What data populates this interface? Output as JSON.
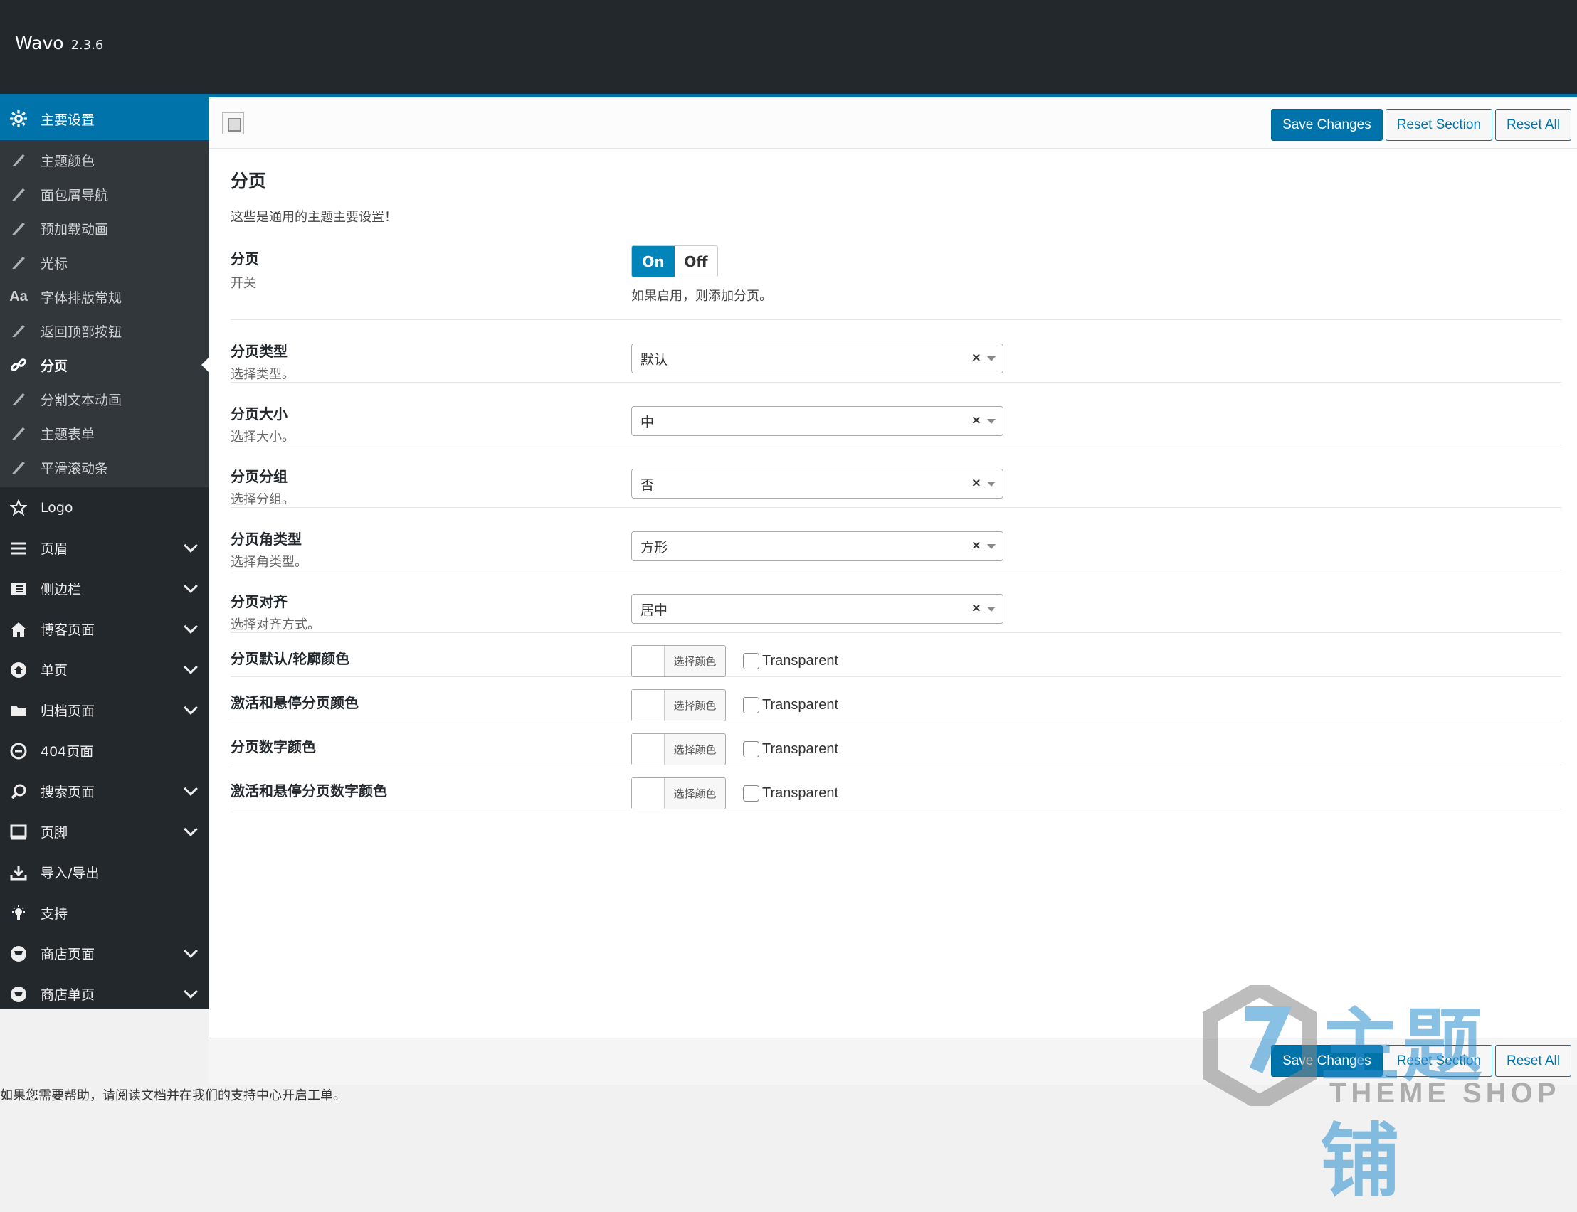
{
  "app": {
    "name": "Wavo",
    "version": "2.3.6"
  },
  "sidebar": {
    "active_section": "主要设置",
    "sub_items": [
      {
        "label": "主题颜色",
        "icon": "brush-icon"
      },
      {
        "label": "面包屑导航",
        "icon": "brush-icon"
      },
      {
        "label": "预加载动画",
        "icon": "brush-icon"
      },
      {
        "label": "光标",
        "icon": "brush-icon"
      },
      {
        "label": "字体排版常规",
        "icon": "font-icon"
      },
      {
        "label": "返回顶部按钮",
        "icon": "brush-icon"
      },
      {
        "label": "分页",
        "icon": "link-icon",
        "current": true
      },
      {
        "label": "分割文本动画",
        "icon": "brush-icon"
      },
      {
        "label": "主题表单",
        "icon": "brush-icon"
      },
      {
        "label": "平滑滚动条",
        "icon": "brush-icon"
      }
    ],
    "main_items": [
      {
        "label": "Logo",
        "icon": "star-icon",
        "expandable": false
      },
      {
        "label": "页眉",
        "icon": "menu-icon",
        "expandable": true
      },
      {
        "label": "侧边栏",
        "icon": "list-icon",
        "expandable": true
      },
      {
        "label": "博客页面",
        "icon": "home-icon",
        "expandable": true
      },
      {
        "label": "单页",
        "icon": "home-circle-icon",
        "expandable": true
      },
      {
        "label": "归档页面",
        "icon": "folder-icon",
        "expandable": true
      },
      {
        "label": "404页面",
        "icon": "minus-circle-icon",
        "expandable": false
      },
      {
        "label": "搜索页面",
        "icon": "search-icon",
        "expandable": true
      },
      {
        "label": "页脚",
        "icon": "monitor-icon",
        "expandable": true
      },
      {
        "label": "导入/导出",
        "icon": "download-icon",
        "expandable": false
      },
      {
        "label": "支持",
        "icon": "lightbulb-icon",
        "expandable": false
      },
      {
        "label": "商店页面",
        "icon": "cart-icon",
        "expandable": true
      },
      {
        "label": "商店单页",
        "icon": "cart-icon",
        "expandable": true
      }
    ]
  },
  "toolbar": {
    "save": "Save Changes",
    "reset_section": "Reset Section",
    "reset_all": "Reset All"
  },
  "section": {
    "title": "分页",
    "desc": "这些是通用的主题主要设置！"
  },
  "toggle": {
    "label": "分页",
    "sub": "开关",
    "on": "On",
    "off": "Off",
    "value": "On",
    "helper": "如果启用，则添加分页。"
  },
  "selects": [
    {
      "label": "分页类型",
      "sub": "选择类型。",
      "value": "默认"
    },
    {
      "label": "分页大小",
      "sub": "选择大小。",
      "value": "中"
    },
    {
      "label": "分页分组",
      "sub": "选择分组。",
      "value": "否"
    },
    {
      "label": "分页角类型",
      "sub": "选择角类型。",
      "value": "方形"
    },
    {
      "label": "分页对齐",
      "sub": "选择对齐方式。",
      "value": "居中"
    }
  ],
  "colors": [
    {
      "label": "分页默认/轮廓颜色",
      "button": "选择颜色",
      "transparent": "Transparent"
    },
    {
      "label": "激活和悬停分页颜色",
      "button": "选择颜色",
      "transparent": "Transparent"
    },
    {
      "label": "分页数字颜色",
      "button": "选择颜色",
      "transparent": "Transparent"
    },
    {
      "label": "激活和悬停分页数字颜色",
      "button": "选择颜色",
      "transparent": "Transparent"
    }
  ],
  "footer_note": "如果您需要帮助，请阅读文档并在我们的支持中心开启工单。",
  "watermark": {
    "text": "主题铺",
    "sub": "THEME SHOP"
  },
  "colors_theme": {
    "accent": "#0073aa",
    "sidebar": "#23282d",
    "sidebar_sub": "#32373c"
  }
}
